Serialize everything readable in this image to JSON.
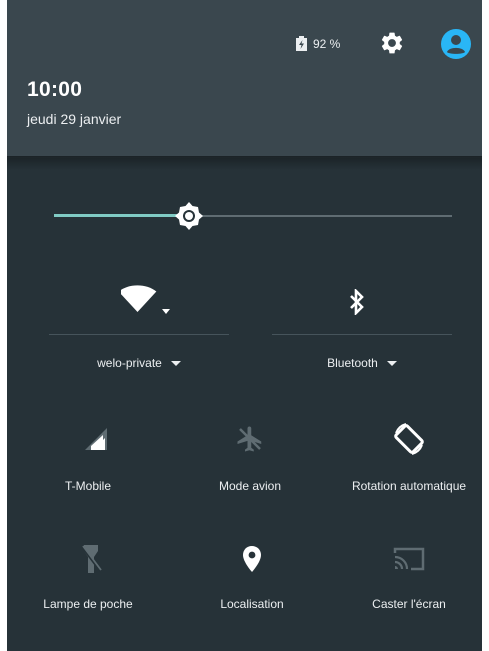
{
  "status": {
    "battery_percent": "92 %",
    "battery_level": 0.92
  },
  "header": {
    "time": "10:00",
    "date": "jeudi 29 janvier"
  },
  "brightness": {
    "level": 0.34
  },
  "wifi": {
    "icon": "wifi-icon",
    "label": "welo-private"
  },
  "bluetooth": {
    "icon": "bluetooth-icon",
    "label": "Bluetooth"
  },
  "tiles": [
    {
      "label": "T-Mobile",
      "icon": "cellular-signal-icon",
      "active": true
    },
    {
      "label": "Mode avion",
      "icon": "airplane-icon",
      "active": false
    },
    {
      "label": "Rotation automatique",
      "icon": "auto-rotate-icon",
      "active": true
    },
    {
      "label": "Lampe de poche",
      "icon": "flashlight-icon",
      "active": false
    },
    {
      "label": "Localisation",
      "icon": "location-pin-icon",
      "active": true
    },
    {
      "label": "Caster l'écran",
      "icon": "cast-icon",
      "active": false
    }
  ],
  "colors": {
    "panel_bg": "#263238",
    "header_bg": "#3a474e",
    "accent": "#80cbc4",
    "avatar_blue": "#29b6f6",
    "inactive_icon": "#5f6c72"
  }
}
